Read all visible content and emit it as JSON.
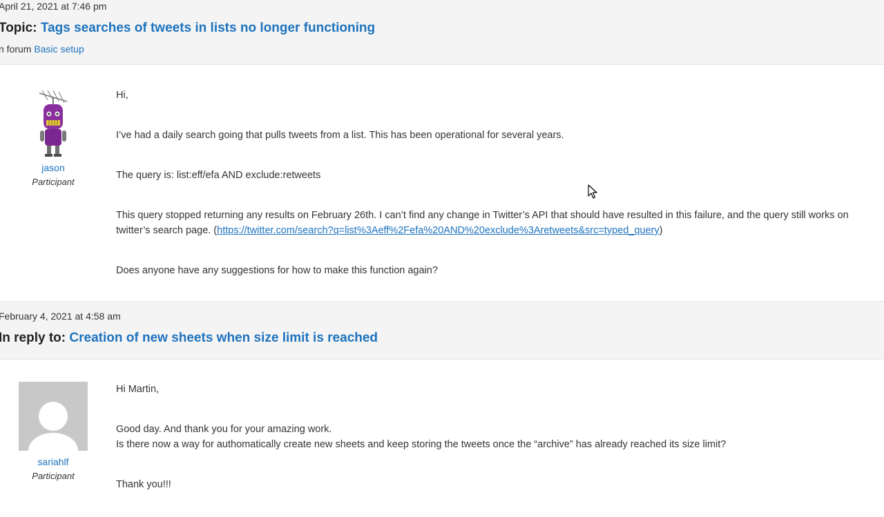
{
  "posts": [
    {
      "timestamp": "April 21, 2021 at 7:46 pm",
      "heading_prefix": "Topic:",
      "heading_link": "Tags searches of tweets in lists no longer functioning",
      "forum_prefix": "n forum",
      "forum_link": "Basic setup",
      "author": {
        "name": "jason",
        "role": "Participant",
        "avatar": "purple-robot-avatar"
      },
      "body": {
        "p1": "Hi,",
        "p2": "I’ve had a daily search going that pulls tweets from a list. This has been operational for several years.",
        "p3": "The query is: list:eff/efa AND exclude:retweets",
        "p4_text": "This query stopped returning any results on February 26th. I can’t find any change in Twitter’s API that should have resulted in this failure, and the query still works on twitter’s search page. (",
        "p4_link": "https://twitter.com/search?q=list%3Aeff%2Fefa%20AND%20exclude%3Aretweets&src=typed_query",
        "p4_close": ")",
        "p5": "Does anyone have any suggestions for how to make this function again?"
      }
    },
    {
      "timestamp": "February 4, 2021 at 4:58 am",
      "heading_prefix": "In reply to:",
      "heading_link": "Creation of new sheets when size limit is reached",
      "author": {
        "name": "sariahlf",
        "role": "Participant",
        "avatar": "default-user-avatar"
      },
      "body": {
        "p1": "Hi Martin,",
        "p2_line1": "Good day. And thank you for your amazing work.",
        "p2_line2": "Is there now a way for authomatically create new sheets and keep storing the tweets once the “archive” has already reached its size limit?",
        "p3": "Thank you!!!"
      }
    }
  ],
  "colors": {
    "link": "#1e73be",
    "header_bg": "#f4f4f4",
    "text": "#333333"
  }
}
